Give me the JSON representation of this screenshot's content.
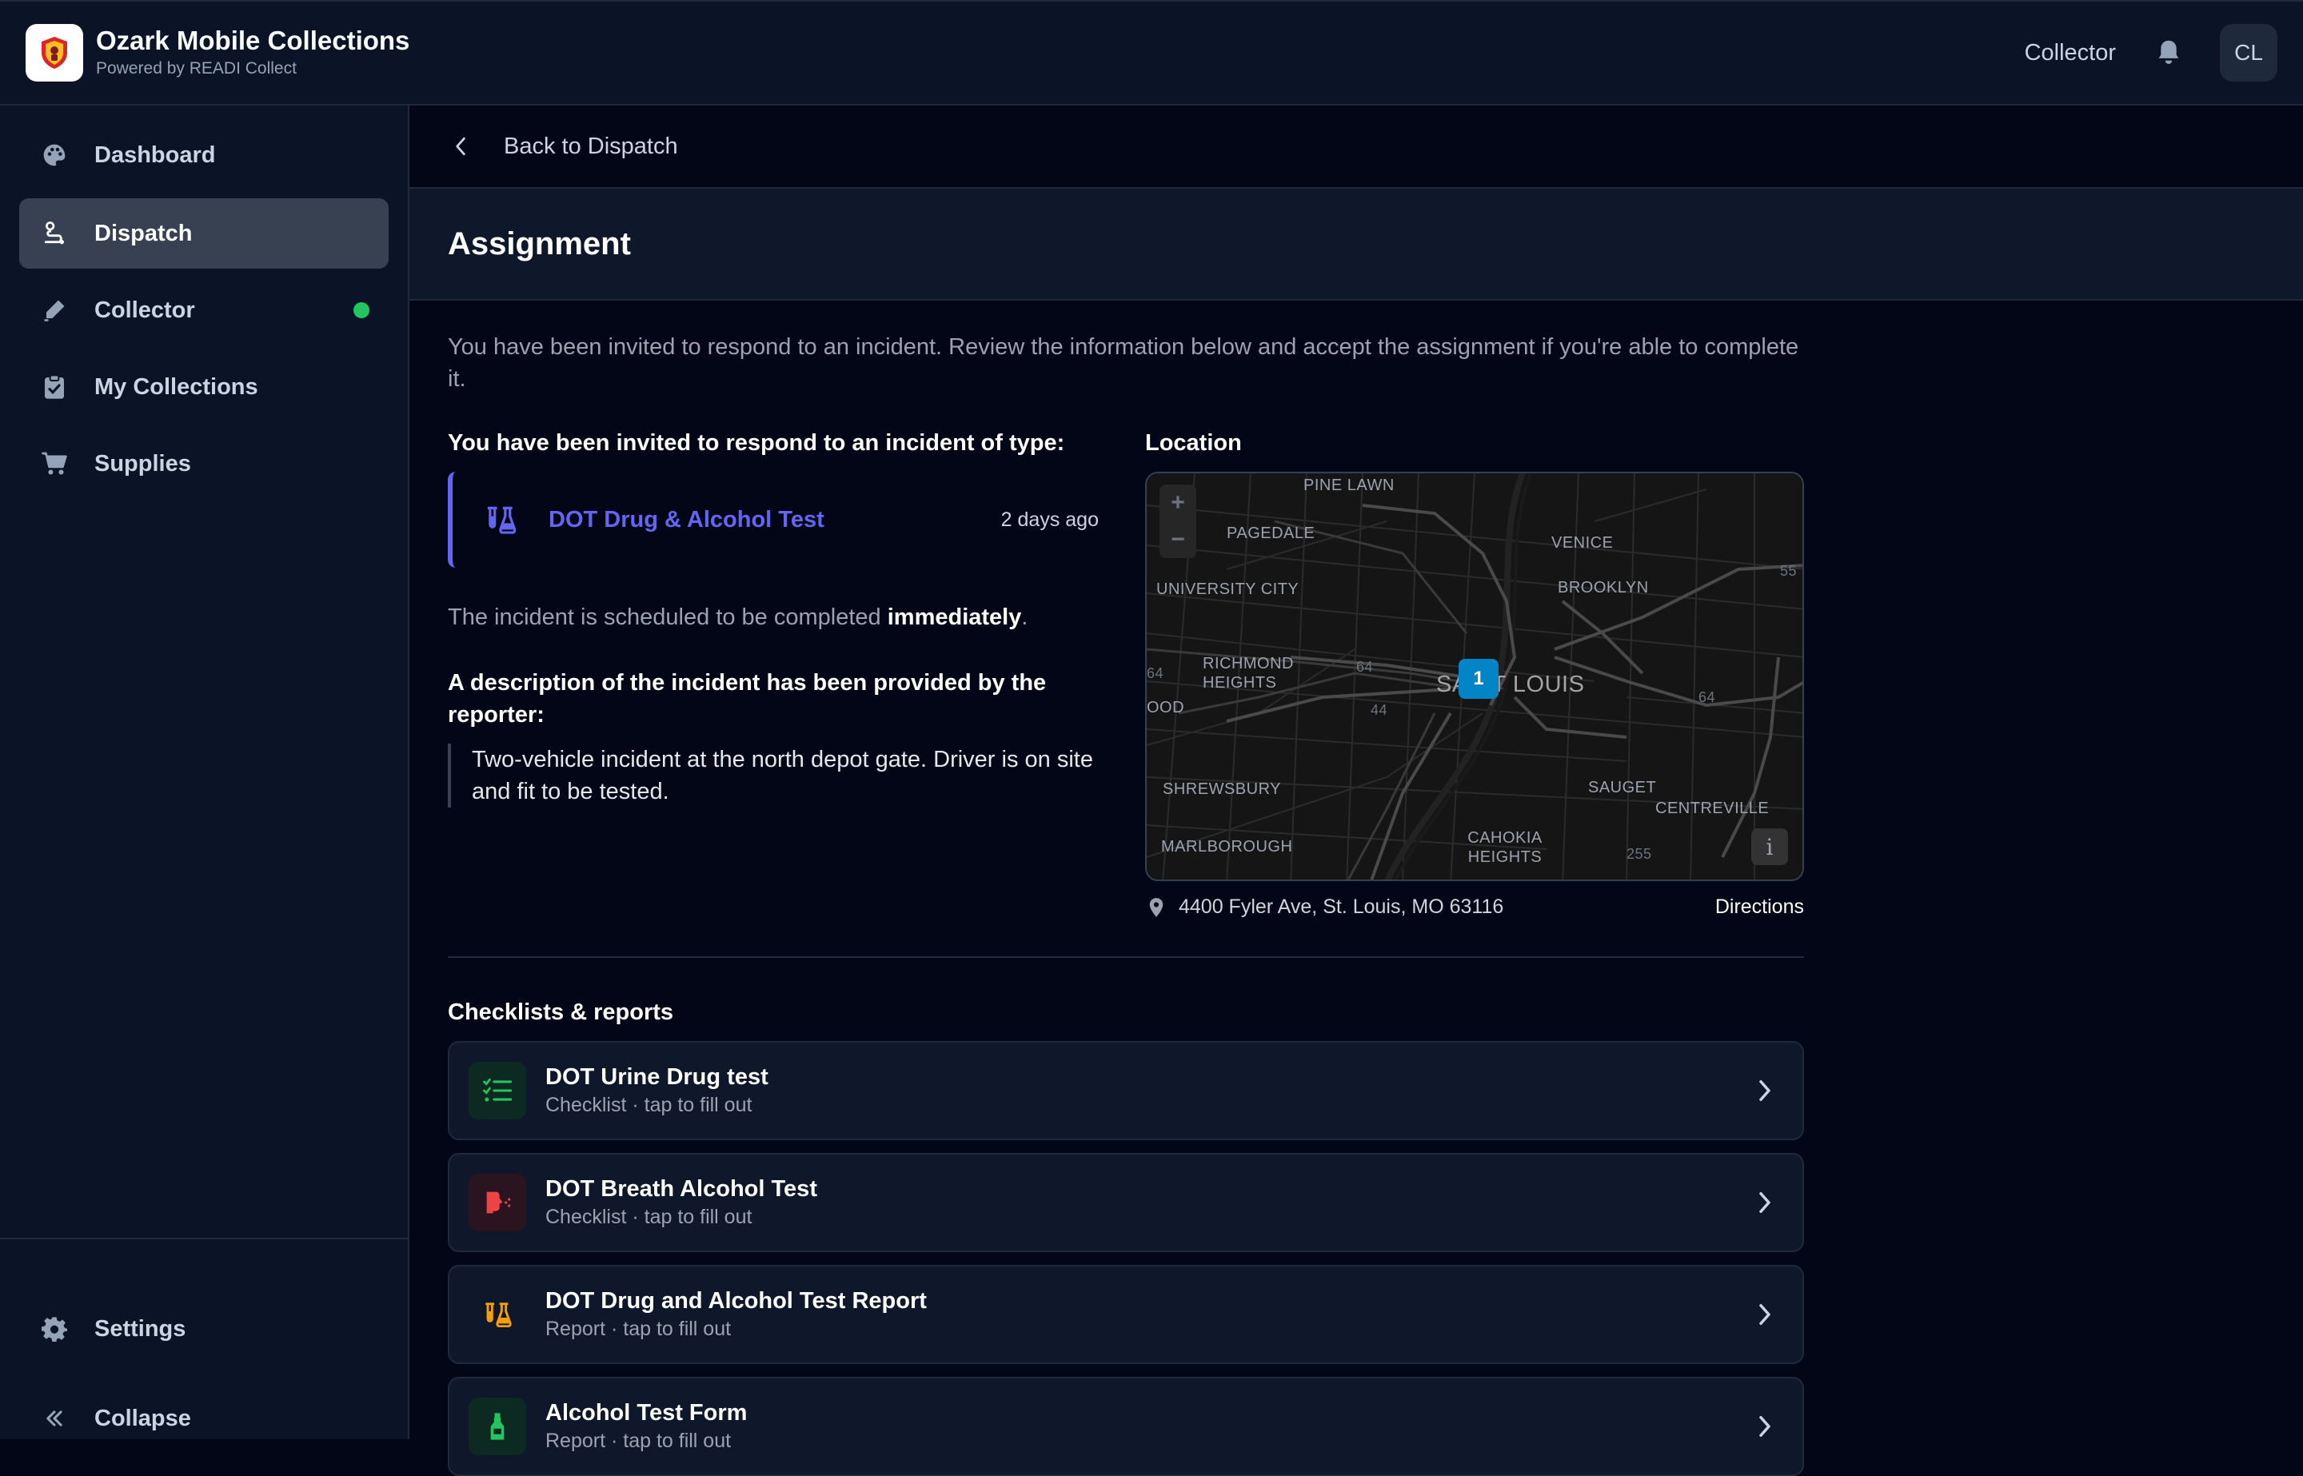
{
  "app": {
    "title": "Ozark Mobile Collections",
    "subtitle": "Powered by READI Collect",
    "role": "Collector",
    "avatar_initials": "CL"
  },
  "sidebar": {
    "items": [
      {
        "label": "Dashboard",
        "icon": "palette-icon",
        "active": false
      },
      {
        "label": "Dispatch",
        "icon": "route-icon",
        "active": true
      },
      {
        "label": "Collector",
        "icon": "pen-icon",
        "active": false,
        "status_dot": "#22c55e"
      },
      {
        "label": "My Collections",
        "icon": "clipboard-check-icon",
        "active": false
      },
      {
        "label": "Supplies",
        "icon": "cart-icon",
        "active": false
      }
    ],
    "settings_label": "Settings",
    "collapse_label": "Collapse"
  },
  "page": {
    "back_label": "Back to Dispatch",
    "title": "Assignment",
    "intro": "You have been invited to respond to an incident. Review the information below and accept the assignment if you're able to complete it."
  },
  "incident": {
    "type_heading": "You have been invited to respond to an incident of type:",
    "type_name": "DOT Drug & Alcohol Test",
    "time_ago": "2 days ago",
    "schedule_prefix": "The incident is scheduled to be completed ",
    "schedule_value": "immediately",
    "schedule_suffix": ".",
    "description_heading": "A description of the incident has been provided by the reporter:",
    "description": "Two-vehicle incident at the north depot gate. Driver is on site and fit to be tested."
  },
  "location": {
    "heading": "Location",
    "address": "4400 Fyler Ave, St. Louis, MO 63116",
    "directions_label": "Directions",
    "marker_label": "1",
    "zoom_in": "+",
    "zoom_out": "−",
    "info": "i",
    "map_labels": {
      "pine_lawn": "PINE LAWN",
      "pagedale": "PAGEDALE",
      "venice": "VENICE",
      "university_city": "UNIVERSITY CITY",
      "brooklyn": "BROOKLYN",
      "richmond_heights": "RICHMOND HEIGHTS",
      "st_louis": "SAINT LOUIS",
      "ood": "OOD",
      "shrewsbury": "SHREWSBURY",
      "sauget": "SAUGET",
      "centreville": "CENTREVILLE",
      "marlborough": "MARLBOROUGH",
      "cahokia_heights": "CAHOKIA HEIGHTS",
      "r55": "55",
      "r64a": "64",
      "r64b": "64",
      "r64c": "64",
      "r44": "44",
      "r255": "255"
    }
  },
  "checklists": {
    "heading": "Checklists & reports",
    "items": [
      {
        "title": "DOT Urine Drug test",
        "subtitle": "Checklist · tap to fill out",
        "icon": "checklist-icon",
        "color": "#22c55e",
        "bg": "#0d2a22"
      },
      {
        "title": "DOT Breath Alcohol Test",
        "subtitle": "Checklist · tap to fill out",
        "icon": "breath-icon",
        "color": "#ef4444",
        "bg": "#2a1420"
      },
      {
        "title": "DOT Drug and Alcohol Test Report",
        "subtitle": "Report · tap to fill out",
        "icon": "flask-icon",
        "color": "#f59e0b",
        "bg": "#0f172a"
      },
      {
        "title": "Alcohol Test Form",
        "subtitle": "Report · tap to fill out",
        "icon": "bottle-icon",
        "color": "#22c55e",
        "bg": "#0d2a22"
      }
    ]
  },
  "colors": {
    "accent": "#6366f1",
    "background": "#020617",
    "panel": "#0f172a",
    "online": "#22c55e",
    "marker": "#0284c7"
  }
}
